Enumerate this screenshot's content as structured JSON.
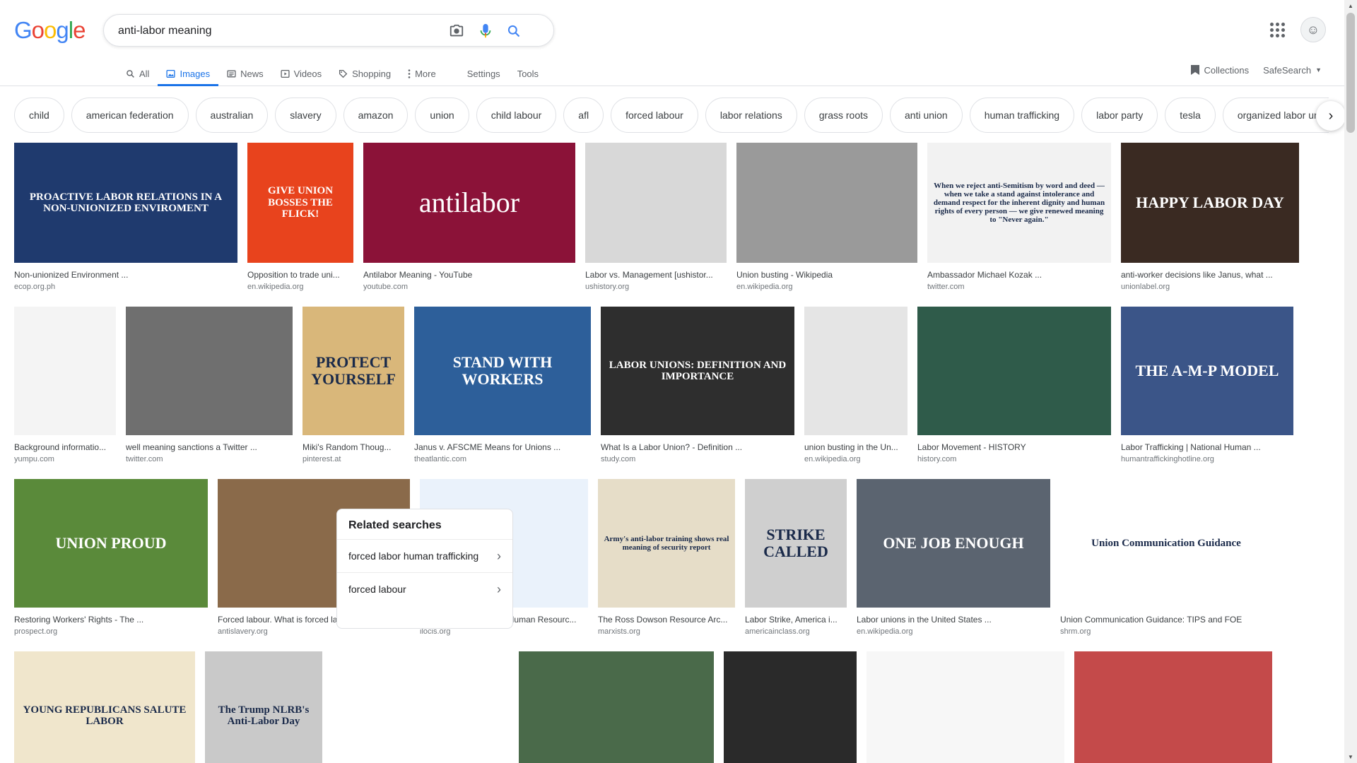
{
  "header": {
    "logo": "Google",
    "logo_colors": [
      "#4285f4",
      "#ea4335",
      "#fbbc05",
      "#4285f4",
      "#34a853",
      "#ea4335"
    ],
    "query": "anti-labor meaning"
  },
  "tabs": [
    {
      "label": "All",
      "icon": "search-icon"
    },
    {
      "label": "Images",
      "icon": "image-icon"
    },
    {
      "label": "News",
      "icon": "news-icon"
    },
    {
      "label": "Videos",
      "icon": "video-icon"
    },
    {
      "label": "Shopping",
      "icon": "tag-icon"
    },
    {
      "label": "More",
      "icon": "more-vert-icon"
    }
  ],
  "tools": {
    "settings": "Settings",
    "tools": "Tools"
  },
  "right": {
    "collections": "Collections",
    "safesearch": "SafeSearch"
  },
  "chips": [
    "child",
    "american federation",
    "australian",
    "slavery",
    "amazon",
    "union",
    "child labour",
    "afl",
    "forced labour",
    "labor relations",
    "grass roots",
    "anti union",
    "human trafficking",
    "labor party",
    "tesla",
    "organized labor unions"
  ],
  "accent": "#1a73e8",
  "rows": [
    [
      {
        "caption": "Non-unionized Environment ...",
        "source": "ecop.org.ph",
        "thumb_text": "PROACTIVE LABOR RELATIONS IN A NON-UNIONIZED ENVIROMENT",
        "bg": "#1f3a6e"
      },
      {
        "caption": "Opposition to trade uni...",
        "source": "en.wikipedia.org",
        "thumb_text": "GIVE UNION BOSSES THE FLICK!",
        "bg": "#e8431d"
      },
      {
        "caption": "Antilabor Meaning - YouTube",
        "source": "youtube.com",
        "thumb_text": "antilabor",
        "bg": "#8b1238"
      },
      {
        "caption": "Labor vs. Management [ushistor...",
        "source": "ushistory.org",
        "thumb_text": "",
        "bg": "#d8d8d8"
      },
      {
        "caption": "Union busting - Wikipedia",
        "source": "en.wikipedia.org",
        "thumb_text": "",
        "bg": "#9a9a9a"
      },
      {
        "caption": "Ambassador Michael Kozak ...",
        "source": "twitter.com",
        "thumb_text": "When we reject anti-Semitism by word and deed — when we take a stand against intolerance and demand respect for the inherent dignity and human rights of every person — we give renewed meaning to \"Never again.\"",
        "bg": "#f2f2f2"
      },
      {
        "caption": "anti-worker decisions like Janus, what ...",
        "source": "unionlabel.org",
        "thumb_text": "HAPPY LABOR DAY",
        "bg": "#3a2a22"
      }
    ],
    [
      {
        "caption": "Background informatio...",
        "source": "yumpu.com",
        "thumb_text": "",
        "bg": "#f4f4f4"
      },
      {
        "caption": "well meaning sanctions a Twitter ...",
        "source": "twitter.com",
        "thumb_text": "",
        "bg": "#6f6f6f"
      },
      {
        "caption": "Miki's Random Thoug...",
        "source": "pinterest.at",
        "thumb_text": "PROTECT YOURSELF",
        "bg": "#d9b77a"
      },
      {
        "caption": "Janus v. AFSCME Means for Unions ...",
        "source": "theatlantic.com",
        "thumb_text": "STAND WITH WORKERS",
        "bg": "#2d5f9a"
      },
      {
        "caption": "What Is a Labor Union? - Definition ...",
        "source": "study.com",
        "thumb_text": "LABOR UNIONS: DEFINITION AND IMPORTANCE",
        "bg": "#2e2e2e"
      },
      {
        "caption": "union busting in the Un...",
        "source": "en.wikipedia.org",
        "thumb_text": "",
        "bg": "#e5e5e5"
      },
      {
        "caption": "Labor Movement - HISTORY",
        "source": "history.com",
        "thumb_text": "",
        "bg": "#2f5b4a"
      },
      {
        "caption": "Labor Trafficking | National Human ...",
        "source": "humantraffickinghotline.org",
        "thumb_text": "THE A-M-P MODEL",
        "bg": "#3b5588"
      }
    ],
    [
      {
        "caption": "Restoring Workers' Rights - The ...",
        "source": "prospect.org",
        "thumb_text": "UNION PROUD",
        "bg": "#5a8a3a"
      },
      {
        "caption": "Forced labour. What is forced labour ...",
        "source": "antislavery.org",
        "thumb_text": "",
        "bg": "#8a6a4a"
      },
      {
        "caption": "Labour Resources and Human Resourc...",
        "source": "ilocis.org",
        "thumb_text": "",
        "bg": "#eaf2fb"
      },
      {
        "caption": "The Ross Dowson Resource Arc...",
        "source": "marxists.org",
        "thumb_text": "Army's anti-labor training shows real meaning of security report",
        "bg": "#e6ddc8"
      },
      {
        "caption": "Labor Strike, America i...",
        "source": "americainclass.org",
        "thumb_text": "STRIKE CALLED",
        "bg": "#cfcfcf"
      },
      {
        "caption": "Labor unions in the United States ...",
        "source": "en.wikipedia.org",
        "thumb_text": "ONE JOB ENOUGH",
        "bg": "#5b6470"
      },
      {
        "caption": "Union Communication Guidance: TIPS and FOE",
        "source": "shrm.org",
        "thumb_text": "Union Communication Guidance",
        "bg": "#ffffff"
      }
    ],
    [
      {
        "caption": "",
        "source": "",
        "thumb_text": "YOUNG REPUBLICANS SALUTE LABOR",
        "bg": "#f0e6cc"
      },
      {
        "caption": "",
        "source": "",
        "thumb_text": "The Trump NLRB's Anti-Labor Day",
        "bg": "#c9c9c9"
      },
      {
        "caption": "",
        "source": "",
        "thumb_text": "",
        "bg": "#4a6a4a"
      },
      {
        "caption": "",
        "source": "",
        "thumb_text": "",
        "bg": "#2a2a2a"
      },
      {
        "caption": "",
        "source": "",
        "thumb_text": "",
        "bg": "#f7f7f7"
      },
      {
        "caption": "",
        "source": "",
        "thumb_text": "",
        "bg": "#c44a4a"
      }
    ]
  ],
  "related": {
    "title": "Related searches",
    "items": [
      "forced labor human trafficking",
      "forced labour"
    ]
  }
}
